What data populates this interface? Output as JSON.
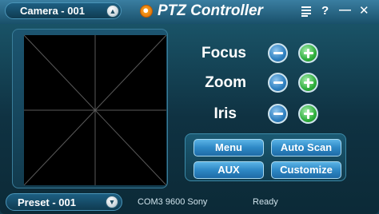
{
  "window": {
    "title": "PTZ Controller",
    "icons": [
      "menu-icon",
      "help-icon",
      "minimize-icon",
      "close-icon"
    ]
  },
  "camera_select": {
    "value": "Camera - 001"
  },
  "controls": [
    {
      "label": "Focus"
    },
    {
      "label": "Zoom"
    },
    {
      "label": "Iris"
    }
  ],
  "buttons": {
    "menu": "Menu",
    "auto_scan": "Auto Scan",
    "aux": "AUX",
    "customize": "Customize"
  },
  "preset_select": {
    "value": "Preset - 001"
  },
  "status": {
    "connection": "COM3 9600 Sony",
    "state": "Ready"
  },
  "colors": {
    "accent": "#2e88c5",
    "minus": "#2e7fbf",
    "plus": "#2fae3c",
    "logo": "#f39a1b"
  }
}
